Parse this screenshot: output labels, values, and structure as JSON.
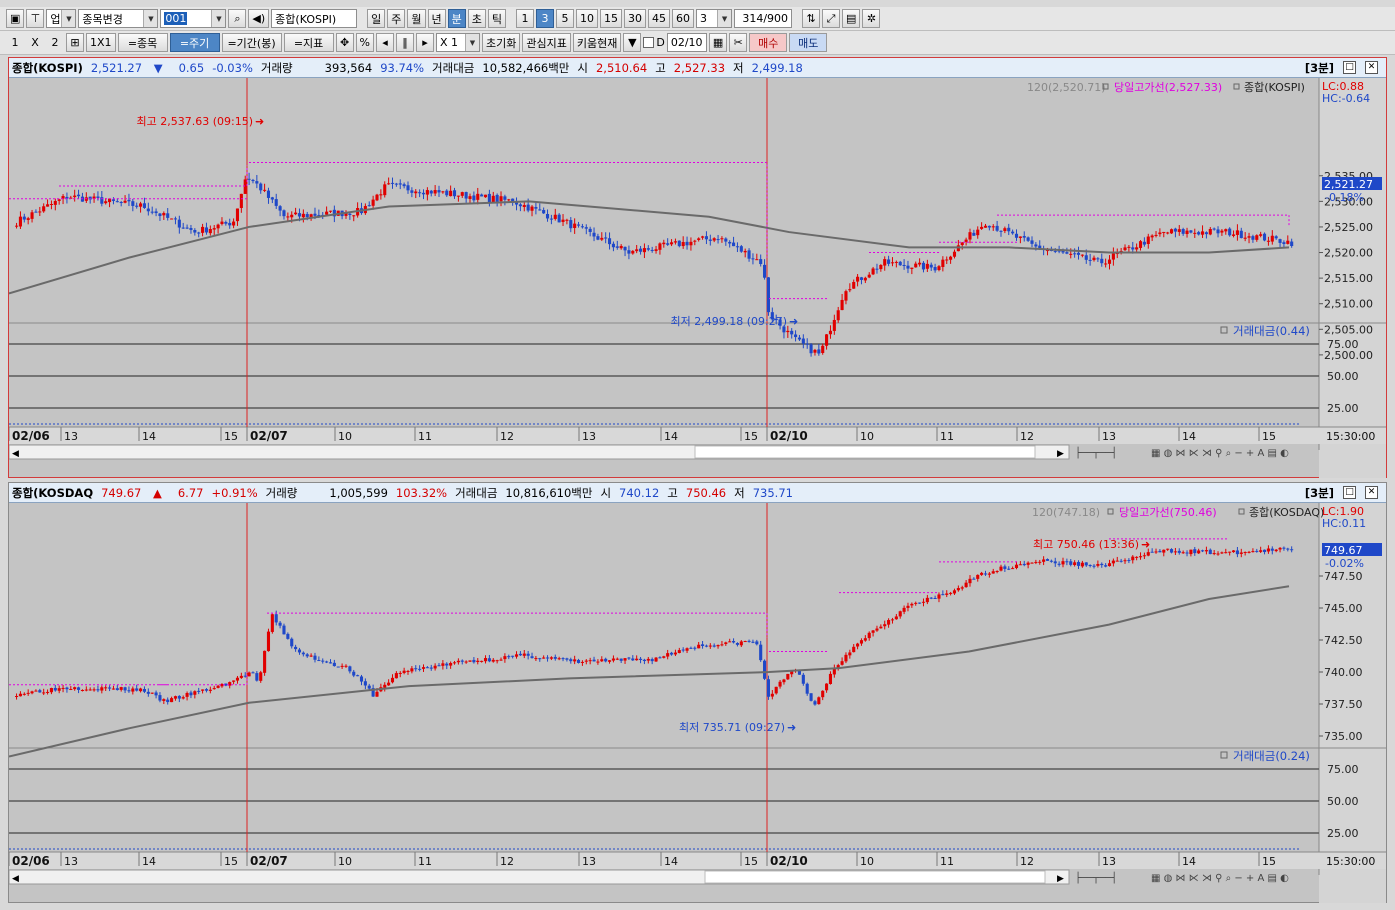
{
  "toolbar1": {
    "market": "업",
    "change_label": "종목변경",
    "code": "001",
    "name": "종합(KOSPI)",
    "periods": [
      "일",
      "주",
      "월",
      "년",
      "분",
      "초",
      "틱"
    ],
    "selected_period": "분",
    "minutes": [
      "1",
      "3",
      "5",
      "10",
      "15",
      "30",
      "45",
      "60"
    ],
    "selected_minute": "3",
    "interval_value": "3",
    "count": "314",
    "count_max": "/900"
  },
  "toolbar2": {
    "layout_1": "1",
    "layout_x": "X",
    "layout_2": "2",
    "one_by_one": "1X1",
    "btn_item": "=종목",
    "btn_period": "=주기",
    "btn_range": "=기간(봉)",
    "btn_indicator": "=지표",
    "pct": "%",
    "zoom": "X 1",
    "reset": "초기화",
    "watch": "관심지표",
    "kiwoom": "키움현재",
    "d_label": "D",
    "date": "02/10",
    "buy": "매수",
    "sell": "매도"
  },
  "panes": [
    {
      "name": "종합(KOSPI)",
      "price": "2,521.27",
      "dir": "▼",
      "change": "0.65",
      "pct": "-0.03%",
      "vol_label": "거래량",
      "vol": "393,564",
      "vol_pct": "93.74%",
      "amt_label": "거래대금",
      "amt": "10,582,466백만",
      "open_label": "시",
      "open": "2,510.64",
      "high_label": "고",
      "high": "2,527.33",
      "low_label": "저",
      "low": "2,499.18",
      "period_box": "[3분]",
      "legend_ma": "120(2,520.71)",
      "legend_high": "당일고가선(2,527.33)",
      "legend_name": "종합(KOSPI)",
      "lc": "LC:0.88",
      "hc": "HC:-0.64",
      "last_price": "2,521.27",
      "last_pct": "-0.18%",
      "max_label": "최고 2,537.63 (09:15)",
      "min_label": "최저 2,499.18 (09:27)",
      "sub_label": "거래대금(0.44)",
      "y_ticks": [
        "2,535.00",
        "2,530.00",
        "2,525.00",
        "2,520.00",
        "2,515.00",
        "2,510.00",
        "2,505.00",
        "2,500.00"
      ],
      "sub_ticks": [
        "75.00",
        "50.00",
        "25.00"
      ],
      "x_labels": [
        "02/06",
        "13",
        "14",
        "15",
        "02/07",
        "10",
        "11",
        "12",
        "13",
        "14",
        "15",
        "02/10",
        "10",
        "11",
        "12",
        "13",
        "14",
        "15"
      ],
      "time_label": "15:30:00"
    },
    {
      "name": "종합(KOSDAQ",
      "price": "749.67",
      "dir": "▲",
      "change": "6.77",
      "pct": "+0.91%",
      "vol_label": "거래량",
      "vol": "1,005,599",
      "vol_pct": "103.32%",
      "amt_label": "거래대금",
      "amt": "10,816,610백만",
      "open_label": "시",
      "open": "740.12",
      "high_label": "고",
      "high": "750.46",
      "low_label": "저",
      "low": "735.71",
      "period_box": "[3분]",
      "legend_ma": "120(747.18)",
      "legend_high": "당일고가선(750.46)",
      "legend_name": "종합(KOSDAQ)",
      "lc": "LC:1.90",
      "hc": "HC:0.11",
      "last_price": "749.67",
      "last_pct": "-0.02%",
      "max_label": "최고 750.46 (13:36)",
      "min_label": "최저 735.71 (09:27)",
      "sub_label": "거래대금(0.24)",
      "y_ticks": [
        "747.50",
        "745.00",
        "742.50",
        "740.00",
        "737.50",
        "735.00"
      ],
      "sub_ticks": [
        "75.00",
        "50.00",
        "25.00"
      ],
      "x_labels": [
        "02/06",
        "13",
        "14",
        "15",
        "02/07",
        "10",
        "11",
        "12",
        "13",
        "14",
        "15",
        "02/10",
        "10",
        "11",
        "12",
        "13",
        "14",
        "15"
      ],
      "time_label": "15:30:00"
    }
  ],
  "colors": {
    "up": "#e00000",
    "down": "#1f48c8",
    "ma": "#6a6a6a",
    "highline": "#e000e0",
    "background": "#c4c4c4"
  }
}
